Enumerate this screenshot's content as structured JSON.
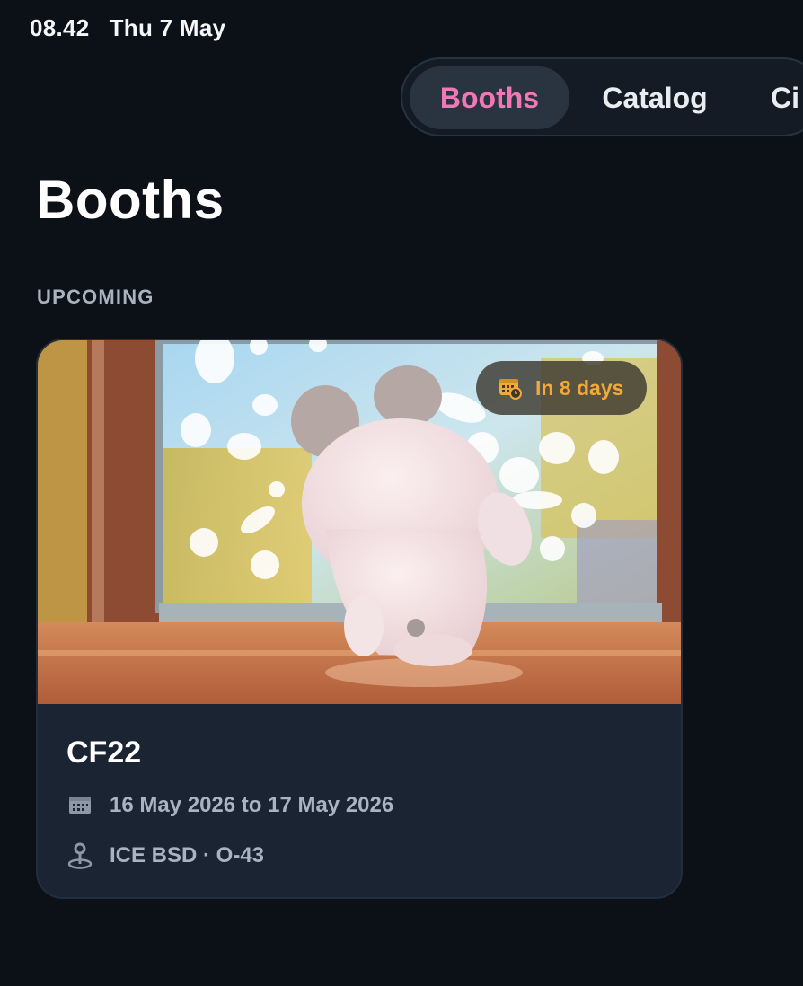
{
  "status_bar": {
    "time": "08.42",
    "date": "Thu 7 May"
  },
  "tabs": [
    {
      "label": "Booths",
      "active": true
    },
    {
      "label": "Catalog",
      "active": false
    },
    {
      "label": "Ci",
      "active": false
    }
  ],
  "page": {
    "title": "Booths",
    "section_label": "UPCOMING"
  },
  "booth_card": {
    "badge": {
      "icon": "calendar-clock-icon",
      "text": "In 8 days"
    },
    "title": "CF22",
    "date_icon": "calendar-icon",
    "date_range": "16 May 2026 to 17 May 2026",
    "location_icon": "map-pin-icon",
    "location": "ICE BSD · O-43"
  },
  "colors": {
    "background": "#0c1118",
    "active_tab_text": "#f178b6",
    "badge_text": "#f3a93a",
    "card_background": "#1b2432"
  }
}
